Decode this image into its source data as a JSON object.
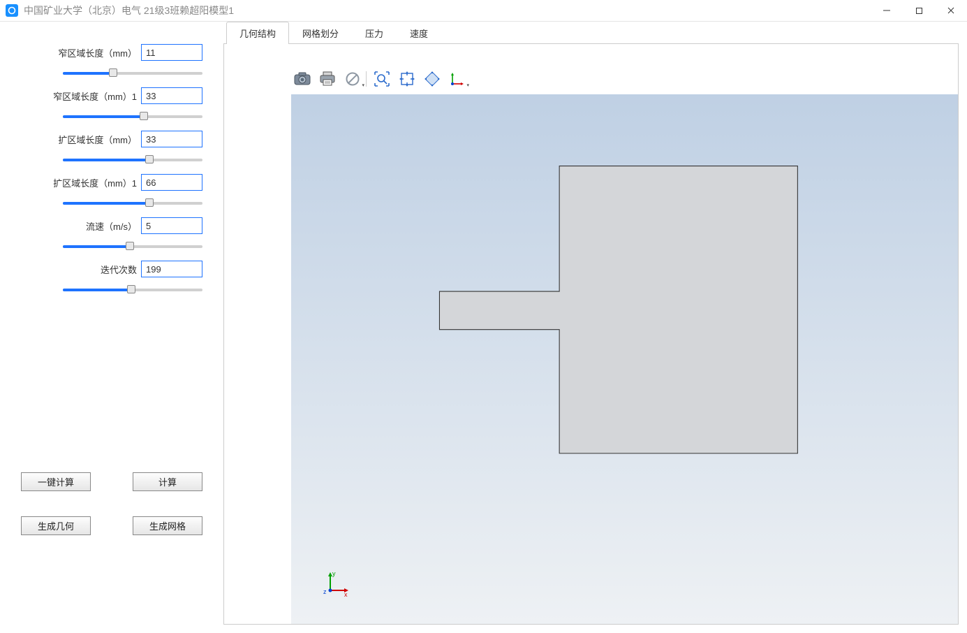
{
  "window": {
    "title": "中国矿业大学（北京）电气 21级3班赖超阳模型1"
  },
  "params": [
    {
      "label": "窄区域长度（mm）",
      "value": "11",
      "pct": 36
    },
    {
      "label": "窄区域长度（mm）1",
      "value": "33",
      "pct": 58
    },
    {
      "label": "扩区域长度（mm）",
      "value": "33",
      "pct": 62
    },
    {
      "label": "扩区域长度（mm）1",
      "value": "66",
      "pct": 62
    },
    {
      "label": "流速（m/s）",
      "value": "5",
      "pct": 48
    },
    {
      "label": "迭代次数",
      "value": "199",
      "pct": 49
    }
  ],
  "buttons": {
    "one_click_calc": "一键计算",
    "calc": "计算",
    "gen_geometry": "生成几何",
    "gen_mesh": "生成网格"
  },
  "tabs": [
    {
      "label": "几何结构",
      "active": true
    },
    {
      "label": "网格划分",
      "active": false
    },
    {
      "label": "压力",
      "active": false
    },
    {
      "label": "速度",
      "active": false
    }
  ],
  "axis_labels": {
    "x": "x",
    "y": "y",
    "z": "z"
  }
}
